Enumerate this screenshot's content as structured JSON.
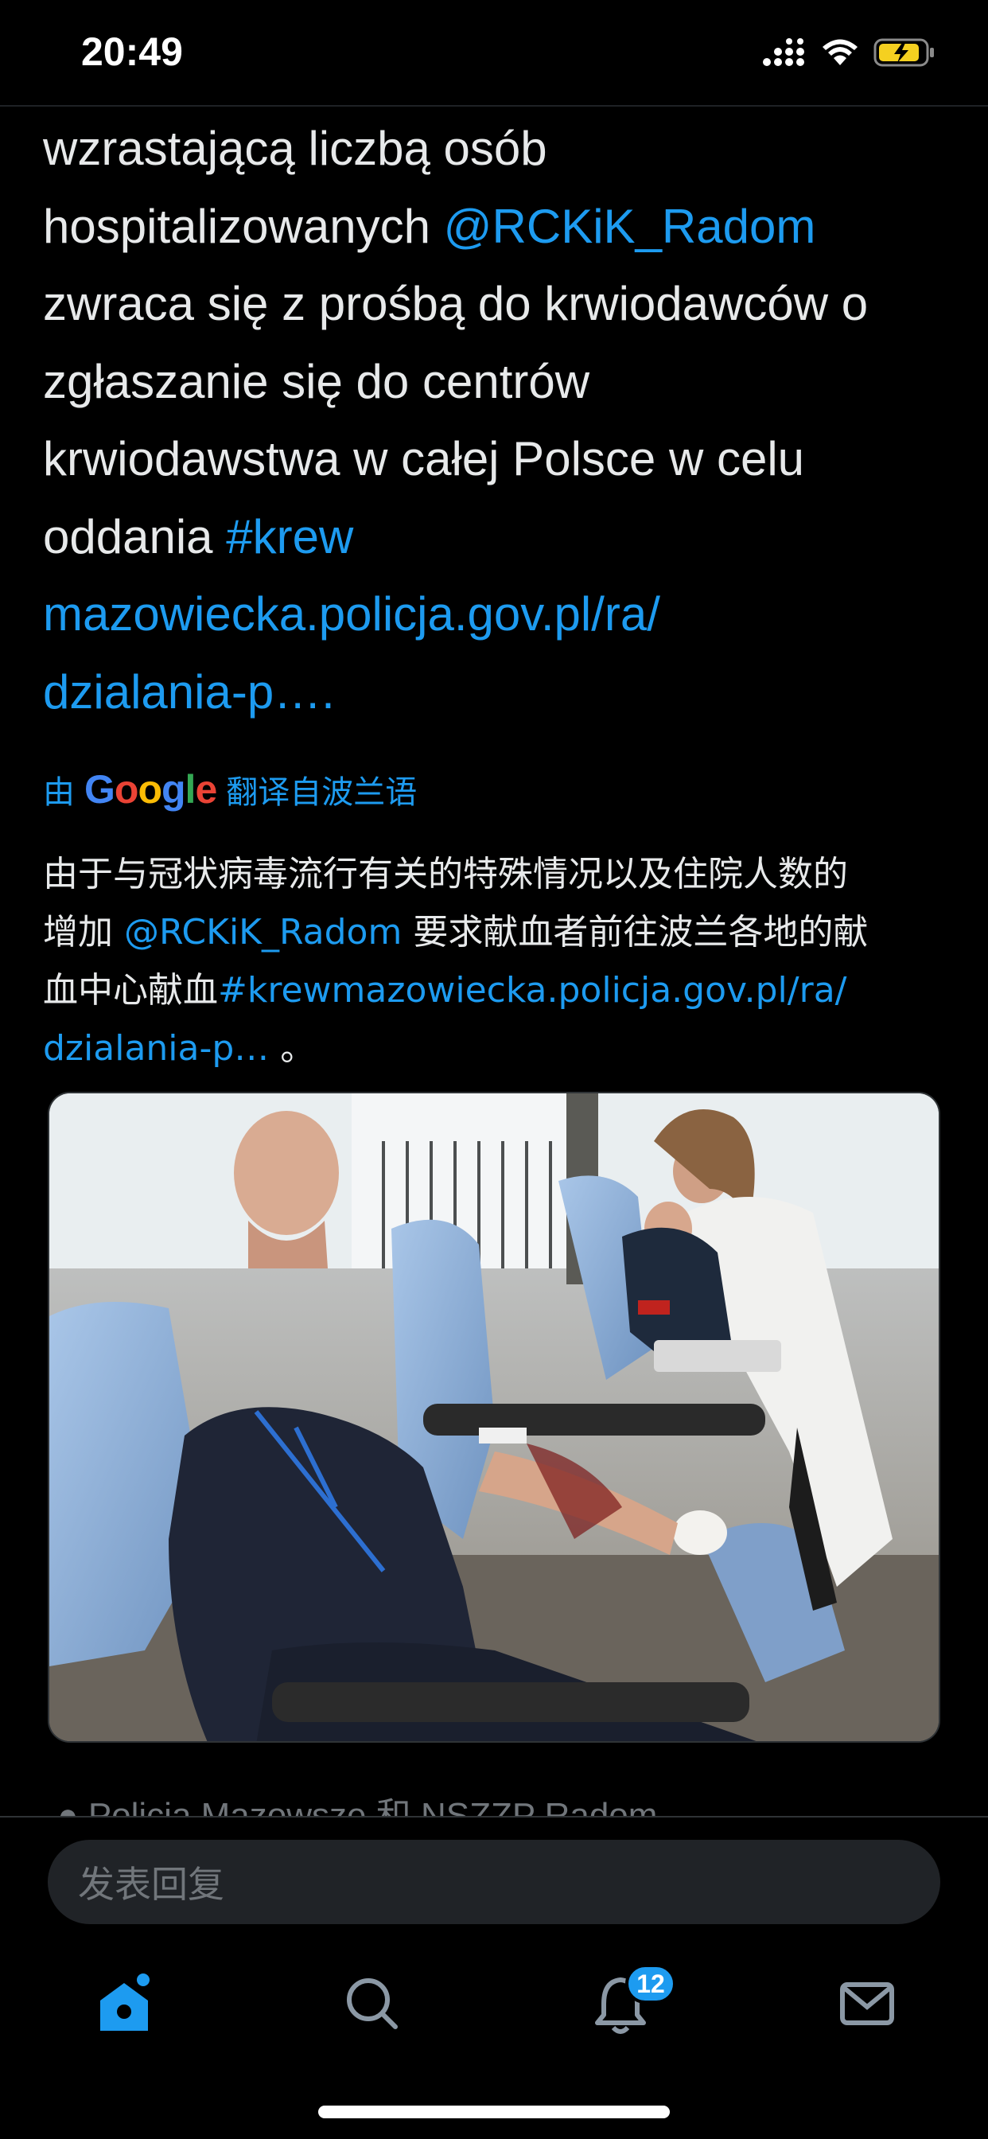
{
  "status": {
    "time": "20:49"
  },
  "tweet": {
    "line1": "wzrastającą liczbą osób",
    "line2_pre": "hospitalizowanych ",
    "line2_mention": "@RCKiK_Radom",
    "line3": "zwraca się z prośbą do krwiodawców o",
    "line4": "zgłaszanie się do centrów",
    "line5": "krwiodawstwa w całej Polsce w celu",
    "line6_pre": "oddania ",
    "line6_hashtag": "#krew",
    "line7_link": "mazowiecka.policja.gov.pl/ra/",
    "line8_link": "dzialania-p….",
    "line8_end": ""
  },
  "translation": {
    "by_prefix": "由",
    "google": "Google",
    "by_suffix": "翻译自波兰语",
    "line1": "由于与冠状病毒流行有关的特殊情况以及住院人数的",
    "line2_pre": "增加 ",
    "line2_mention": "@RCKiK_Radom",
    "line2_post": " 要求献血者前往波兰各地的献",
    "line3_pre": "血中心献血",
    "line3_link": "#krewmazowiecka.policja.gov.pl/ra/",
    "line4_link": "dzialania-p…",
    "line4_post": " 。"
  },
  "media": {
    "description_icon": "photo"
  },
  "cut_line": "Policja Mazowsze 和 NSZZP Radom",
  "reply": {
    "placeholder": "发表回复"
  },
  "tabbar": {
    "notification_count": "12"
  },
  "colors": {
    "accent": "#1d9bf0",
    "background": "#000000",
    "text": "#e7e9ea"
  }
}
